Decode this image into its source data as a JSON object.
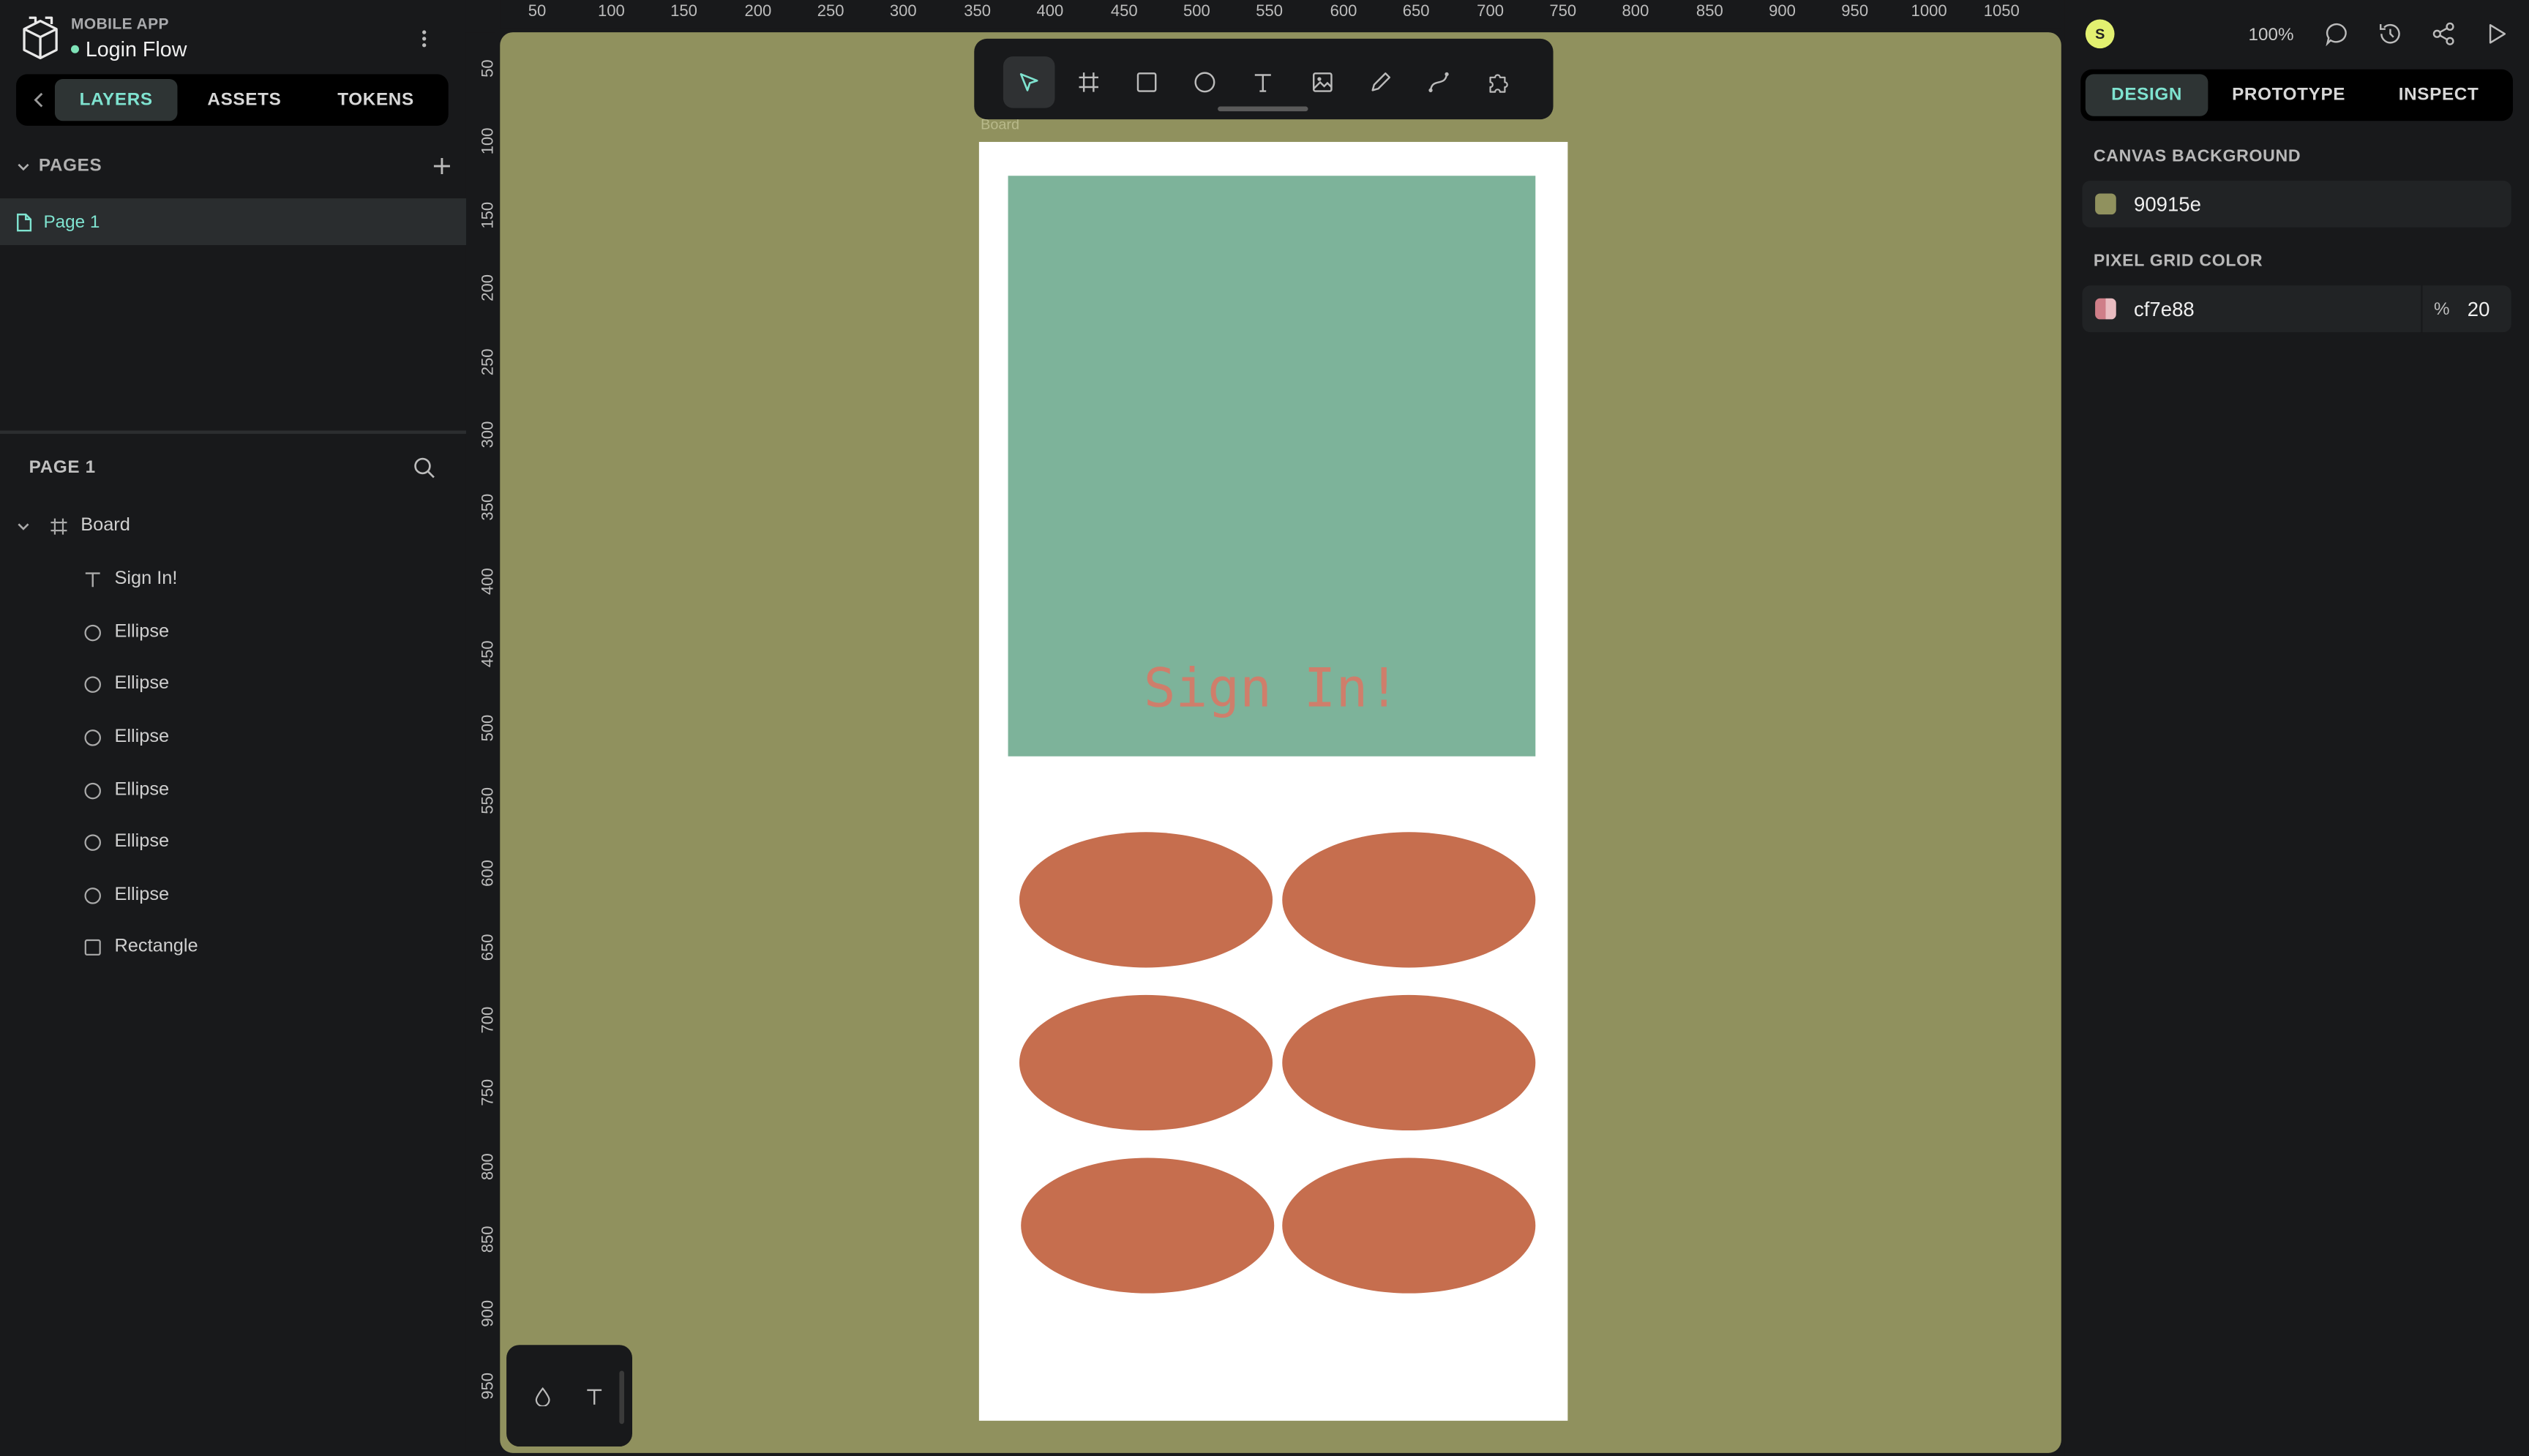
{
  "project": {
    "name": "MOBILE APP",
    "file": "Login Flow"
  },
  "left_tabs": [
    "LAYERS",
    "ASSETS",
    "TOKENS"
  ],
  "pages": {
    "heading": "PAGES",
    "items": [
      "Page 1"
    ]
  },
  "layers": {
    "heading": "PAGE 1",
    "board": "Board",
    "children": [
      {
        "name": "Sign In!",
        "icon": "text-icon"
      },
      {
        "name": "Ellipse",
        "icon": "ellipse-icon"
      },
      {
        "name": "Ellipse",
        "icon": "ellipse-icon"
      },
      {
        "name": "Ellipse",
        "icon": "ellipse-icon"
      },
      {
        "name": "Ellipse",
        "icon": "ellipse-icon"
      },
      {
        "name": "Ellipse",
        "icon": "ellipse-icon"
      },
      {
        "name": "Ellipse",
        "icon": "ellipse-icon"
      },
      {
        "name": "Rectangle",
        "icon": "rectangle-icon"
      }
    ]
  },
  "ruler_top": [
    "50",
    "100",
    "150",
    "200",
    "250",
    "300",
    "350",
    "400",
    "450",
    "500",
    "550",
    "600",
    "650",
    "700",
    "750",
    "800",
    "850",
    "900",
    "950",
    "1000",
    "1050"
  ],
  "ruler_left": [
    "50",
    "100",
    "150",
    "200",
    "250",
    "300",
    "350",
    "400",
    "450",
    "500",
    "550",
    "600",
    "650",
    "700",
    "750",
    "800",
    "850",
    "900",
    "950"
  ],
  "canvas": {
    "board_label": "Board",
    "hero_text": "Sign In!",
    "background_color": "#90915e",
    "hero_color": "#7db39a",
    "ellipse_color": "#c66e4e",
    "text_color": "#cf7e6b"
  },
  "header": {
    "avatar": "S",
    "zoom": "100%"
  },
  "right_tabs": [
    "DESIGN",
    "PROTOTYPE",
    "INSPECT"
  ],
  "design": {
    "canvas_bg_label": "CANVAS BACKGROUND",
    "canvas_bg_value": "90915e",
    "grid_label": "PIXEL GRID COLOR",
    "grid_value": "cf7e88",
    "grid_pct_symbol": "%",
    "grid_opacity": "20"
  }
}
